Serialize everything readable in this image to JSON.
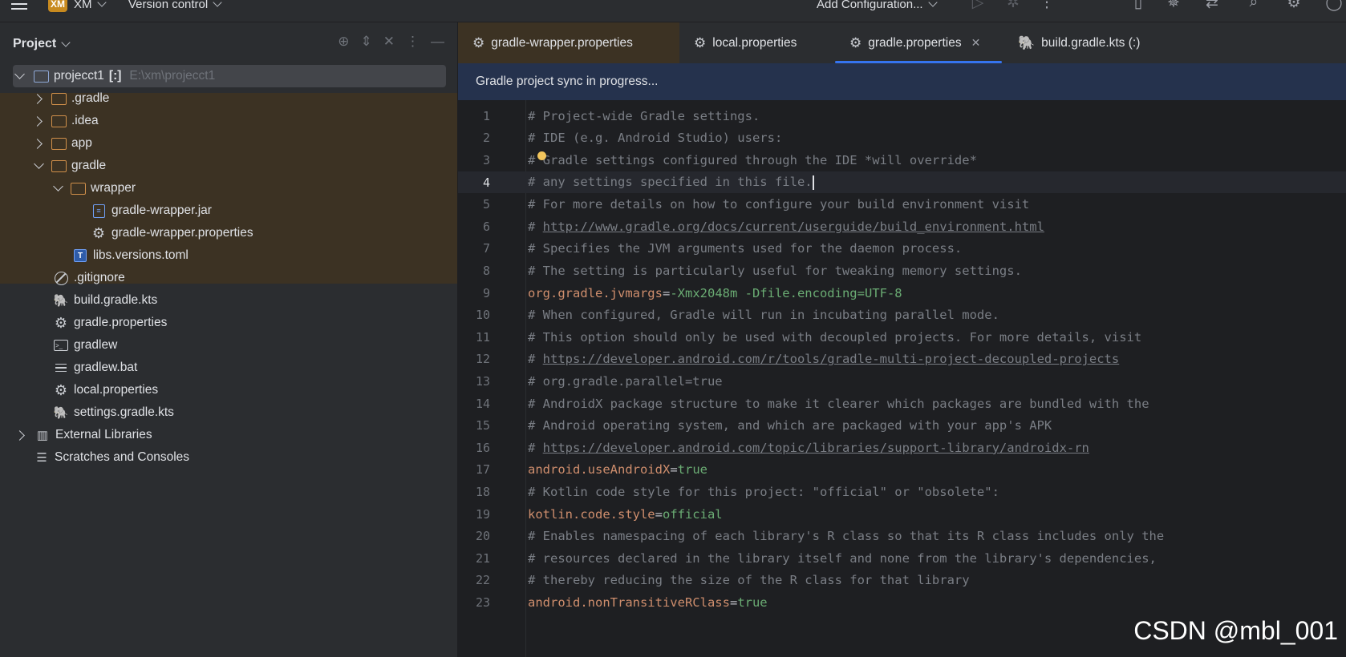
{
  "topbar": {
    "project_badge": "XM",
    "project_name": "XM",
    "version_control": "Version control",
    "add_configuration": "Add Configuration..."
  },
  "project_panel": {
    "title": "Project",
    "tree": [
      {
        "label": "projecct1",
        "flag": "[:]",
        "hint": "E:\\xm\\projecct1"
      },
      {
        "label": ".gradle"
      },
      {
        "label": ".idea"
      },
      {
        "label": "app"
      },
      {
        "label": "gradle"
      },
      {
        "label": "wrapper"
      },
      {
        "label": "gradle-wrapper.jar"
      },
      {
        "label": "gradle-wrapper.properties"
      },
      {
        "label": "libs.versions.toml"
      },
      {
        "label": ".gitignore"
      },
      {
        "label": "build.gradle.kts"
      },
      {
        "label": "gradle.properties"
      },
      {
        "label": "gradlew"
      },
      {
        "label": "gradlew.bat"
      },
      {
        "label": "local.properties"
      },
      {
        "label": "settings.gradle.kts"
      },
      {
        "label": "External Libraries"
      },
      {
        "label": "Scratches and Consoles"
      }
    ]
  },
  "tabs": [
    {
      "label": "gradle-wrapper.properties"
    },
    {
      "label": "local.properties"
    },
    {
      "label": "gradle.properties"
    },
    {
      "label": "build.gradle.kts (:)"
    }
  ],
  "sync_message": "Gradle project sync in progress...",
  "editor": {
    "lines": [
      {
        "n": "1",
        "text": "# Project-wide Gradle settings."
      },
      {
        "n": "2",
        "text": "# IDE (e.g. Android Studio) users:"
      },
      {
        "n": "3",
        "text": "# Gradle settings configured through the IDE *will override*"
      },
      {
        "n": "4",
        "text": "# any settings specified in this file."
      },
      {
        "n": "5",
        "text": "# For more details on how to configure your build environment visit"
      },
      {
        "n": "6",
        "prefix": "# ",
        "url": "http://www.gradle.org/docs/current/userguide/build_environment.html"
      },
      {
        "n": "7",
        "text": "# Specifies the JVM arguments used for the daemon process."
      },
      {
        "n": "8",
        "text": "# The setting is particularly useful for tweaking memory settings."
      },
      {
        "n": "9",
        "key": "org.gradle.jvmargs",
        "value": "-Xmx2048m -Dfile.encoding=UTF-8"
      },
      {
        "n": "10",
        "text": "# When configured, Gradle will run in incubating parallel mode."
      },
      {
        "n": "11",
        "text": "# This option should only be used with decoupled projects. For more details, visit"
      },
      {
        "n": "12",
        "prefix": "# ",
        "url": "https://developer.android.com/r/tools/gradle-multi-project-decoupled-projects"
      },
      {
        "n": "13",
        "text": "# org.gradle.parallel=true"
      },
      {
        "n": "14",
        "text": "# AndroidX package structure to make it clearer which packages are bundled with the"
      },
      {
        "n": "15",
        "text": "# Android operating system, and which are packaged with your app's APK"
      },
      {
        "n": "16",
        "prefix": "# ",
        "url": "https://developer.android.com/topic/libraries/support-library/androidx-rn"
      },
      {
        "n": "17",
        "key": "android.useAndroidX",
        "value": "true"
      },
      {
        "n": "18",
        "text": "# Kotlin code style for this project: \"official\" or \"obsolete\":"
      },
      {
        "n": "19",
        "key": "kotlin.code.style",
        "value": "official"
      },
      {
        "n": "20",
        "text": "# Enables namespacing of each library's R class so that its R class includes only the"
      },
      {
        "n": "21",
        "text": "# resources declared in the library itself and none from the library's dependencies,"
      },
      {
        "n": "22",
        "text": "# thereby reducing the size of the R class for that library"
      },
      {
        "n": "23",
        "key": "android.nonTransitiveRClass",
        "value": "true"
      }
    ]
  },
  "watermark": "CSDN @mbl_001"
}
